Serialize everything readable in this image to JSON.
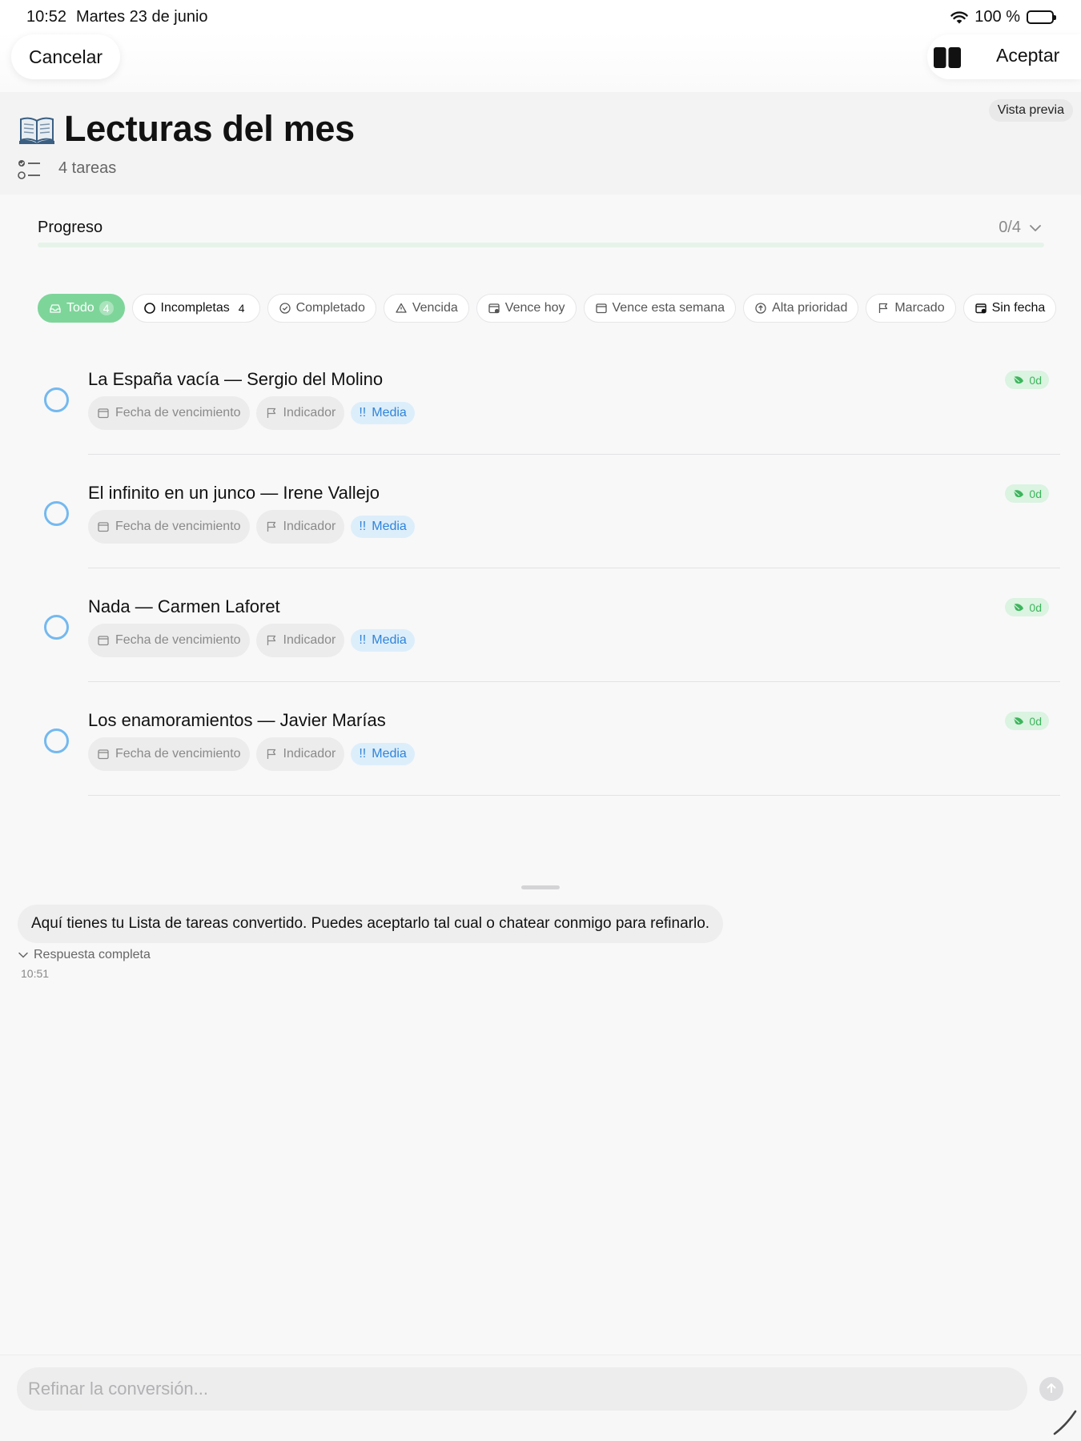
{
  "status_bar": {
    "time": "10:52",
    "date": "Martes 23 de junio",
    "battery": "100 %"
  },
  "nav": {
    "cancel_label": "Cancelar",
    "accept_label": "Aceptar",
    "split_icon": "sidebar-split-icon"
  },
  "header": {
    "preview_badge": "Vista previa",
    "title_icon": "open-book-icon",
    "title": "Lecturas del mes",
    "task_count": "4 tareas"
  },
  "progress": {
    "label": "Progreso",
    "value": "0/4",
    "fraction": 0.0,
    "color": "#6bcf7f"
  },
  "filters": [
    {
      "label": "Todo",
      "count": "4",
      "icon": "inbox-icon",
      "active": true
    },
    {
      "label": "Incompletas",
      "count": "4",
      "icon": "circle-icon",
      "active": false
    },
    {
      "label": "Completado",
      "count": "",
      "icon": "check-circle-icon",
      "active": false
    },
    {
      "label": "Vencida",
      "count": "",
      "icon": "warning-triangle-icon",
      "active": false
    },
    {
      "label": "Vence hoy",
      "count": "",
      "icon": "calendar-today-icon",
      "active": false
    },
    {
      "label": "Vence esta semana",
      "count": "",
      "icon": "calendar-icon",
      "active": false
    },
    {
      "label": "Alta prioridad",
      "count": "",
      "icon": "priority-up-icon",
      "active": false
    },
    {
      "label": "Marcado",
      "count": "",
      "icon": "flag-icon",
      "active": false
    },
    {
      "label": "Sin fecha",
      "count": "",
      "icon": "calendar-none-icon",
      "active": false
    }
  ],
  "tasks": [
    {
      "title": "La España vacía — Sergio del Molino",
      "due_label": "Fecha de vencimiento",
      "flag_label": "Indicador",
      "priority_marks": "!!",
      "priority_label": "Media",
      "timer": "0d"
    },
    {
      "title": "El infinito en un junco — Irene Vallejo",
      "due_label": "Fecha de vencimiento",
      "flag_label": "Indicador",
      "priority_marks": "!!",
      "priority_label": "Media",
      "timer": "0d"
    },
    {
      "title": "Nada — Carmen Laforet",
      "due_label": "Fecha de vencimiento",
      "flag_label": "Indicador",
      "priority_marks": "!!",
      "priority_label": "Media",
      "timer": "0d"
    },
    {
      "title": "Los enamoramientos — Javier Marías",
      "due_label": "Fecha de vencimiento",
      "flag_label": "Indicador",
      "priority_marks": "!!",
      "priority_label": "Media",
      "timer": "0d"
    }
  ],
  "chat": {
    "message": "Aquí tienes tu Lista de tareas convertido. Puedes aceptarlo tal cual o chatear conmigo para refinarlo.",
    "response_toggle": "Respuesta completa",
    "time": "10:51"
  },
  "input": {
    "placeholder": "Refinar la conversión..."
  },
  "colors": {
    "accent_green": "#7ed59a",
    "radio_blue": "#74b9ef",
    "priority_blue": "#2f84d8",
    "timer_green": "#3cb55c"
  }
}
